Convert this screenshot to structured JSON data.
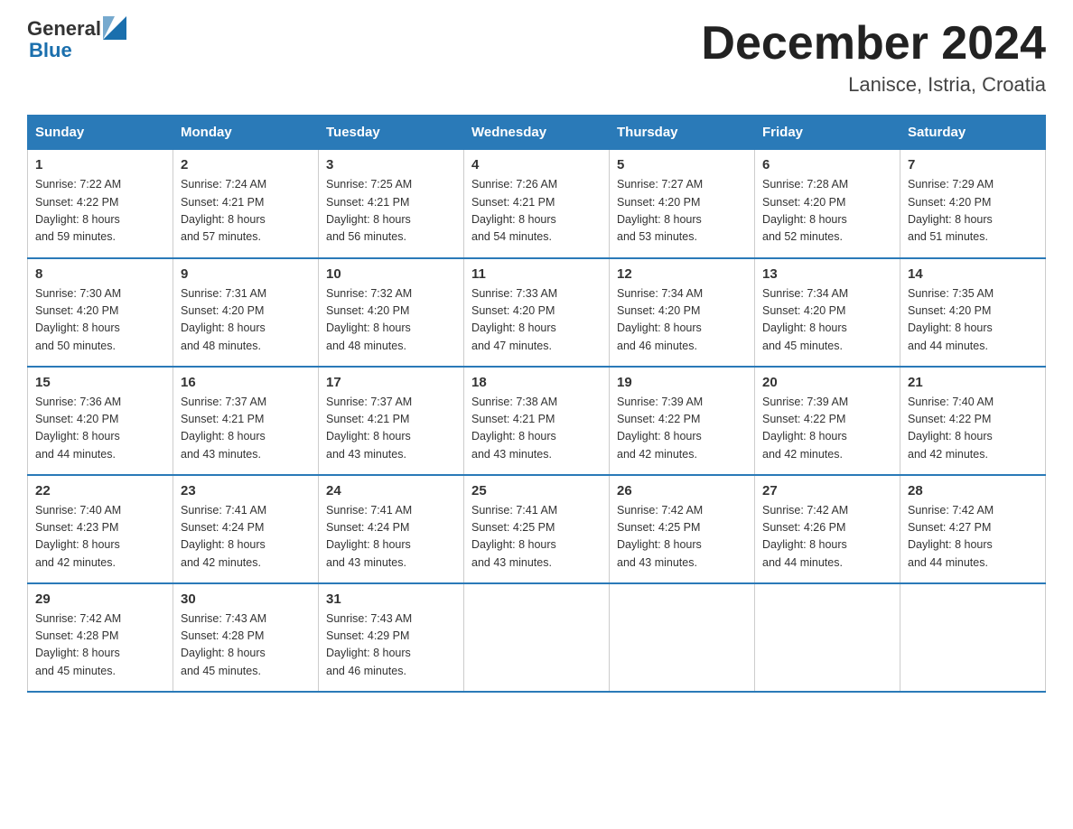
{
  "header": {
    "logo_general": "General",
    "logo_blue": "Blue",
    "month_title": "December 2024",
    "location": "Lanisce, Istria, Croatia"
  },
  "weekdays": [
    "Sunday",
    "Monday",
    "Tuesday",
    "Wednesday",
    "Thursday",
    "Friday",
    "Saturday"
  ],
  "weeks": [
    [
      {
        "day": "1",
        "sunrise": "7:22 AM",
        "sunset": "4:22 PM",
        "daylight": "8 hours and 59 minutes."
      },
      {
        "day": "2",
        "sunrise": "7:24 AM",
        "sunset": "4:21 PM",
        "daylight": "8 hours and 57 minutes."
      },
      {
        "day": "3",
        "sunrise": "7:25 AM",
        "sunset": "4:21 PM",
        "daylight": "8 hours and 56 minutes."
      },
      {
        "day": "4",
        "sunrise": "7:26 AM",
        "sunset": "4:21 PM",
        "daylight": "8 hours and 54 minutes."
      },
      {
        "day": "5",
        "sunrise": "7:27 AM",
        "sunset": "4:20 PM",
        "daylight": "8 hours and 53 minutes."
      },
      {
        "day": "6",
        "sunrise": "7:28 AM",
        "sunset": "4:20 PM",
        "daylight": "8 hours and 52 minutes."
      },
      {
        "day": "7",
        "sunrise": "7:29 AM",
        "sunset": "4:20 PM",
        "daylight": "8 hours and 51 minutes."
      }
    ],
    [
      {
        "day": "8",
        "sunrise": "7:30 AM",
        "sunset": "4:20 PM",
        "daylight": "8 hours and 50 minutes."
      },
      {
        "day": "9",
        "sunrise": "7:31 AM",
        "sunset": "4:20 PM",
        "daylight": "8 hours and 48 minutes."
      },
      {
        "day": "10",
        "sunrise": "7:32 AM",
        "sunset": "4:20 PM",
        "daylight": "8 hours and 48 minutes."
      },
      {
        "day": "11",
        "sunrise": "7:33 AM",
        "sunset": "4:20 PM",
        "daylight": "8 hours and 47 minutes."
      },
      {
        "day": "12",
        "sunrise": "7:34 AM",
        "sunset": "4:20 PM",
        "daylight": "8 hours and 46 minutes."
      },
      {
        "day": "13",
        "sunrise": "7:34 AM",
        "sunset": "4:20 PM",
        "daylight": "8 hours and 45 minutes."
      },
      {
        "day": "14",
        "sunrise": "7:35 AM",
        "sunset": "4:20 PM",
        "daylight": "8 hours and 44 minutes."
      }
    ],
    [
      {
        "day": "15",
        "sunrise": "7:36 AM",
        "sunset": "4:20 PM",
        "daylight": "8 hours and 44 minutes."
      },
      {
        "day": "16",
        "sunrise": "7:37 AM",
        "sunset": "4:21 PM",
        "daylight": "8 hours and 43 minutes."
      },
      {
        "day": "17",
        "sunrise": "7:37 AM",
        "sunset": "4:21 PM",
        "daylight": "8 hours and 43 minutes."
      },
      {
        "day": "18",
        "sunrise": "7:38 AM",
        "sunset": "4:21 PM",
        "daylight": "8 hours and 43 minutes."
      },
      {
        "day": "19",
        "sunrise": "7:39 AM",
        "sunset": "4:22 PM",
        "daylight": "8 hours and 42 minutes."
      },
      {
        "day": "20",
        "sunrise": "7:39 AM",
        "sunset": "4:22 PM",
        "daylight": "8 hours and 42 minutes."
      },
      {
        "day": "21",
        "sunrise": "7:40 AM",
        "sunset": "4:22 PM",
        "daylight": "8 hours and 42 minutes."
      }
    ],
    [
      {
        "day": "22",
        "sunrise": "7:40 AM",
        "sunset": "4:23 PM",
        "daylight": "8 hours and 42 minutes."
      },
      {
        "day": "23",
        "sunrise": "7:41 AM",
        "sunset": "4:24 PM",
        "daylight": "8 hours and 42 minutes."
      },
      {
        "day": "24",
        "sunrise": "7:41 AM",
        "sunset": "4:24 PM",
        "daylight": "8 hours and 43 minutes."
      },
      {
        "day": "25",
        "sunrise": "7:41 AM",
        "sunset": "4:25 PM",
        "daylight": "8 hours and 43 minutes."
      },
      {
        "day": "26",
        "sunrise": "7:42 AM",
        "sunset": "4:25 PM",
        "daylight": "8 hours and 43 minutes."
      },
      {
        "day": "27",
        "sunrise": "7:42 AM",
        "sunset": "4:26 PM",
        "daylight": "8 hours and 44 minutes."
      },
      {
        "day": "28",
        "sunrise": "7:42 AM",
        "sunset": "4:27 PM",
        "daylight": "8 hours and 44 minutes."
      }
    ],
    [
      {
        "day": "29",
        "sunrise": "7:42 AM",
        "sunset": "4:28 PM",
        "daylight": "8 hours and 45 minutes."
      },
      {
        "day": "30",
        "sunrise": "7:43 AM",
        "sunset": "4:28 PM",
        "daylight": "8 hours and 45 minutes."
      },
      {
        "day": "31",
        "sunrise": "7:43 AM",
        "sunset": "4:29 PM",
        "daylight": "8 hours and 46 minutes."
      },
      null,
      null,
      null,
      null
    ]
  ],
  "labels": {
    "sunrise": "Sunrise:",
    "sunset": "Sunset:",
    "daylight": "Daylight:"
  }
}
